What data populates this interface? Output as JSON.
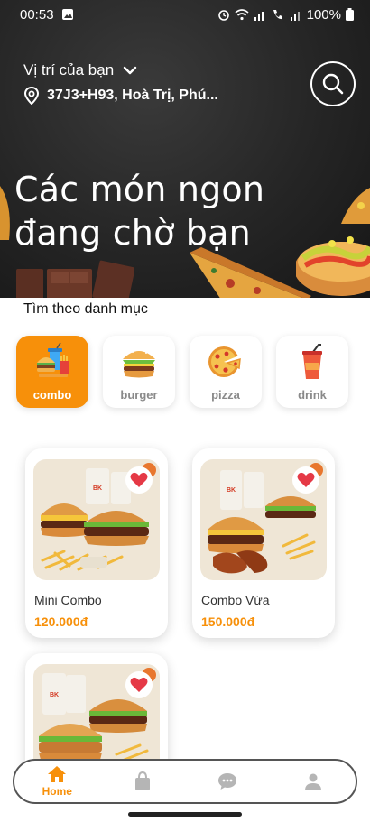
{
  "status_bar": {
    "time": "00:53",
    "battery": "100%"
  },
  "location": {
    "label": "Vị trí của bạn",
    "address": "37J3+H93, Hoà Trị, Phú..."
  },
  "hero": {
    "title": "Các món ngon đang chờ bạn"
  },
  "categories": {
    "title": "Tìm theo danh mục",
    "items": [
      {
        "label": "combo",
        "icon": "combo-icon",
        "active": true
      },
      {
        "label": "burger",
        "icon": "burger-icon",
        "active": false
      },
      {
        "label": "pizza",
        "icon": "pizza-icon",
        "active": false
      },
      {
        "label": "drink",
        "icon": "drink-icon",
        "active": false
      }
    ]
  },
  "products": [
    {
      "name": "Mini Combo",
      "price": "120.000đ"
    },
    {
      "name": "Combo Vừa",
      "price": "150.000đ"
    },
    {
      "name": "",
      "price": ""
    }
  ],
  "bottom_nav": {
    "items": [
      {
        "label": "Home",
        "icon": "home-icon",
        "active": true
      },
      {
        "label": "",
        "icon": "shopping-bag-icon",
        "active": false
      },
      {
        "label": "",
        "icon": "chat-icon",
        "active": false
      },
      {
        "label": "",
        "icon": "profile-icon",
        "active": false
      }
    ]
  },
  "colors": {
    "accent": "#f7900a",
    "heart": "#e53946",
    "hero_bg": "#252525"
  }
}
